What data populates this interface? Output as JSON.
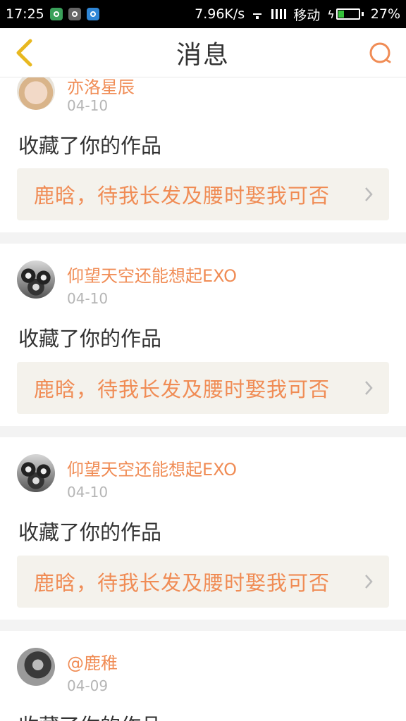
{
  "status_bar": {
    "time": "17:25",
    "speed": "7.96K/s",
    "carrier": "移动",
    "battery_percent": "27%",
    "battery_level": 0.27,
    "icons": [
      "shield-icon",
      "app-icon",
      "download-icon",
      "wifi-icon",
      "signal-icon",
      "battery-icon"
    ]
  },
  "header": {
    "title": "消息",
    "back_icon": "chevron-left-icon",
    "search_icon": "search-icon",
    "accent_color": "#f08c55"
  },
  "messages": [
    {
      "username": "亦洛星辰",
      "date": "04-10",
      "action": "收藏了你的作品",
      "work_title": "鹿晗，待我长发及腰时娶我可否"
    },
    {
      "username": "仰望天空还能想起EXO",
      "date": "04-10",
      "action": "收藏了你的作品",
      "work_title": "鹿晗，待我长发及腰时娶我可否"
    },
    {
      "username": "仰望天空还能想起EXO",
      "date": "04-10",
      "action": "收藏了你的作品",
      "work_title": "鹿晗，待我长发及腰时娶我可否"
    },
    {
      "username": "@鹿稚",
      "date": "04-09",
      "action": "收藏了你的作品",
      "work_title": ""
    }
  ]
}
